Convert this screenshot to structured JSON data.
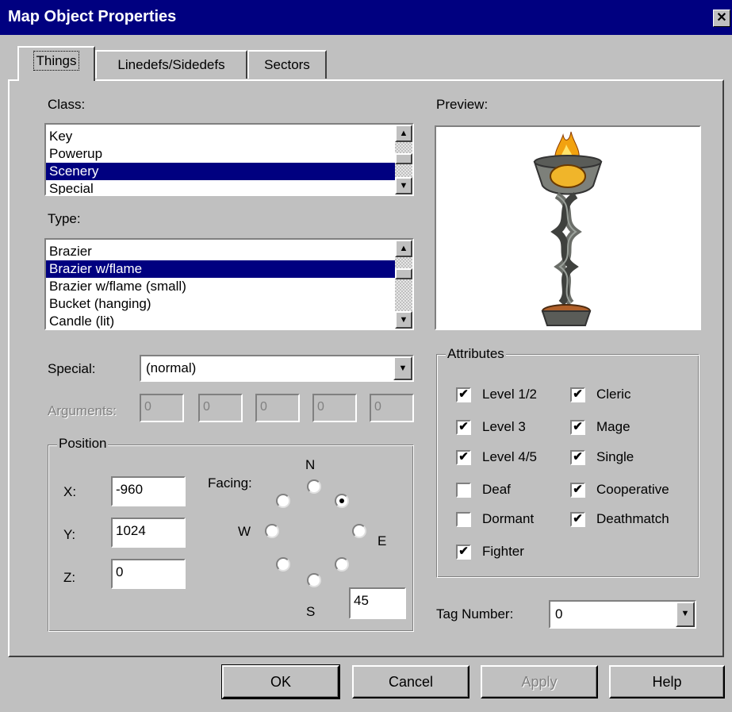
{
  "window": {
    "title": "Map Object Properties",
    "close_glyph": "✕"
  },
  "tabs": [
    {
      "label": "Things",
      "active": true
    },
    {
      "label": "Linedefs/Sidedefs",
      "active": false
    },
    {
      "label": "Sectors",
      "active": false
    }
  ],
  "class": {
    "label": "Class:",
    "items": [
      "Key",
      "Powerup",
      "Scenery",
      "Special"
    ],
    "selected": "Scenery"
  },
  "type": {
    "label": "Type:",
    "items": [
      "Brazier",
      "Brazier w/flame",
      "Brazier w/flame (small)",
      "Bucket (hanging)",
      "Candle (lit)"
    ],
    "selected": "Brazier w/flame"
  },
  "special": {
    "label": "Special:",
    "value": "(normal)"
  },
  "arguments": {
    "label": "Arguments:",
    "values": [
      "0",
      "0",
      "0",
      "0",
      "0"
    ]
  },
  "position": {
    "title": "Position",
    "x_label": "X:",
    "x_value": "-960",
    "y_label": "Y:",
    "y_value": "1024",
    "z_label": "Z:",
    "z_value": "0",
    "facing_label": "Facing:",
    "facing_value": "45",
    "compass": {
      "n": "N",
      "s": "S",
      "e": "E",
      "w": "W"
    },
    "selected_direction": "NE"
  },
  "preview": {
    "label": "Preview:",
    "image": "brazier-with-flame"
  },
  "attributes": {
    "title": "Attributes",
    "left": [
      {
        "label": "Level 1/2",
        "checked": true
      },
      {
        "label": "Level 3",
        "checked": true
      },
      {
        "label": "Level 4/5",
        "checked": true
      },
      {
        "label": "Deaf",
        "checked": false
      },
      {
        "label": "Dormant",
        "checked": false
      },
      {
        "label": "Fighter",
        "checked": true
      }
    ],
    "right": [
      {
        "label": "Cleric",
        "checked": true
      },
      {
        "label": "Mage",
        "checked": true
      },
      {
        "label": "Single",
        "checked": true
      },
      {
        "label": "Cooperative",
        "checked": true
      },
      {
        "label": "Deathmatch",
        "checked": true
      }
    ]
  },
  "tag": {
    "label": "Tag Number:",
    "value": "0"
  },
  "buttons": {
    "ok": "OK",
    "cancel": "Cancel",
    "apply": "Apply",
    "help": "Help"
  },
  "check_glyph": "✔",
  "arrows": {
    "up": "▲",
    "down": "▼"
  }
}
